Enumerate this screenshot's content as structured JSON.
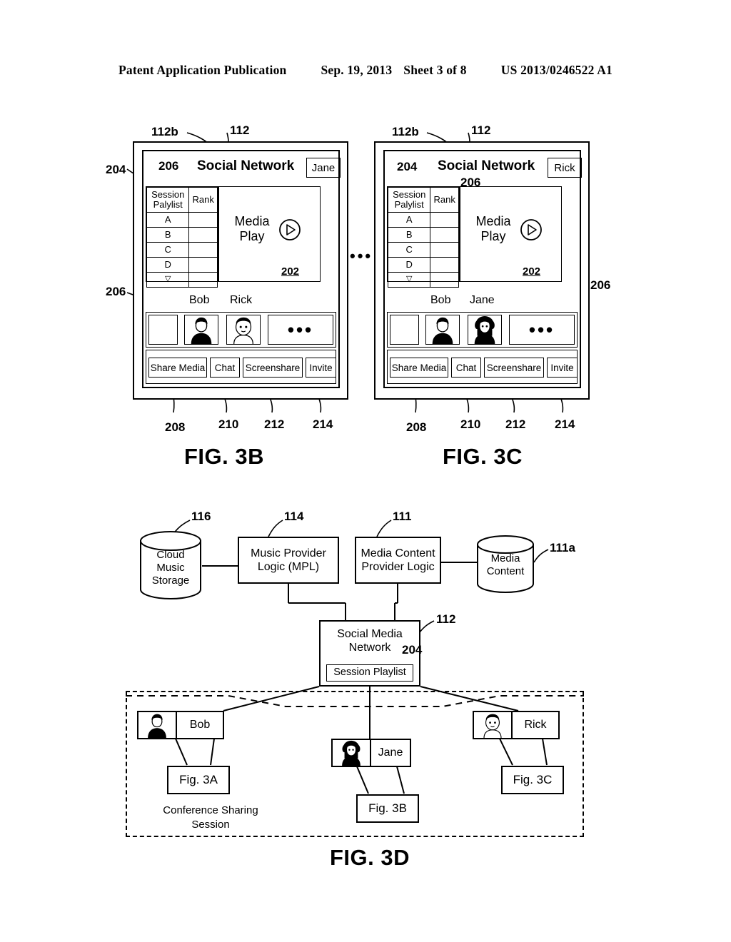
{
  "header": {
    "publication": "Patent Application Publication",
    "date": "Sep. 19, 2013",
    "sheet": "Sheet 3 of 8",
    "number": "US 2013/0246522 A1"
  },
  "figures": {
    "fig3b": {
      "caption": "FIG. 3B",
      "app_title": "Social Network",
      "current_user": "Jane",
      "playlist": {
        "col_header_1_line1": "Session",
        "col_header_1_line2": "Palylist",
        "col_header_2": "Rank",
        "rows": [
          "A",
          "B",
          "C",
          "D"
        ],
        "more_glyph": "▽"
      },
      "media": {
        "line1": "Media",
        "line2": "Play",
        "ref": "202",
        "play_icon": "play-circle-icon"
      },
      "participant_names": [
        "Bob",
        "Rick"
      ],
      "thumbnails": [
        "empty-thumbnail",
        "bob-avatar-icon",
        "rick-avatar-icon",
        "more-dots"
      ],
      "more_dots": "•••",
      "buttons": [
        "Share Media",
        "Chat",
        "Screenshare",
        "Invite"
      ],
      "refs": {
        "device": "112b",
        "screen": "112",
        "rank": "206",
        "playlist": "204",
        "participants": "206",
        "btn_share": "208",
        "btn_chat": "210",
        "btn_screenshare": "212",
        "btn_invite": "214"
      }
    },
    "fig3c": {
      "caption": "FIG. 3C",
      "app_title": "Social Network",
      "current_user": "Rick",
      "playlist": {
        "col_header_1_line1": "Session",
        "col_header_1_line2": "Palylist",
        "col_header_2": "Rank",
        "rows": [
          "A",
          "B",
          "C",
          "D"
        ],
        "more_glyph": "▽"
      },
      "media": {
        "line1": "Media",
        "line2": "Play",
        "ref": "202",
        "play_icon": "play-circle-icon"
      },
      "participant_names": [
        "Bob",
        "Jane"
      ],
      "thumbnails": [
        "empty-thumbnail",
        "bob-avatar-icon",
        "jane-avatar-icon",
        "more-dots"
      ],
      "more_dots": "•••",
      "buttons": [
        "Share Media",
        "Chat",
        "Screenshare",
        "Invite"
      ],
      "refs": {
        "device": "112b",
        "screen": "112",
        "playlist": "204",
        "rank": "206",
        "participants": "206",
        "btn_share": "208",
        "btn_chat": "210",
        "btn_screenshare": "212",
        "btn_invite": "214"
      }
    },
    "between_figures_ellipsis": "•••",
    "fig3d": {
      "caption": "FIG. 3D",
      "nodes": {
        "cloud_storage": {
          "line1": "Cloud",
          "line2": "Music",
          "line3": "Storage",
          "ref": "116"
        },
        "mpl": {
          "line1": "Music Provider",
          "line2": "Logic (MPL)",
          "ref": "114"
        },
        "mcpl": {
          "line1": "Media Content",
          "line2": "Provider Logic",
          "ref": "111"
        },
        "media_content": {
          "line1": "Media",
          "line2": "Content",
          "ref": "111a"
        },
        "smn": {
          "line1": "Social Media",
          "line2": "Network",
          "ref": "112",
          "inner_label": "Session Playlist",
          "inner_ref": "204"
        }
      },
      "session": {
        "label_line1": "Conference Sharing",
        "label_line2": "Session",
        "participants": [
          {
            "name": "Bob",
            "avatar": "bob-avatar-icon",
            "figure": "Fig. 3A"
          },
          {
            "name": "Jane",
            "avatar": "jane-avatar-icon",
            "figure": "Fig. 3B"
          },
          {
            "name": "Rick",
            "avatar": "rick-avatar-icon",
            "figure": "Fig. 3C"
          }
        ]
      }
    }
  }
}
